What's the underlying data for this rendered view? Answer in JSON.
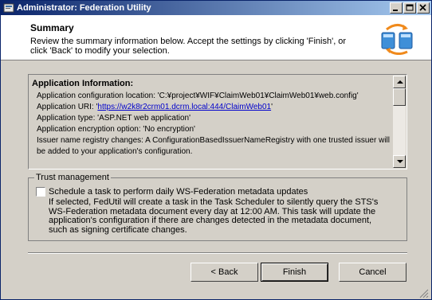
{
  "window": {
    "title": "Administrator: Federation Utility"
  },
  "header": {
    "title": "Summary",
    "description": "Review the summary information below. Accept the settings by clicking 'Finish', or click 'Back' to modify your selection."
  },
  "summary": {
    "heading": "Application Information:",
    "config_location": "Application configuration location: 'C:¥project¥WIF¥ClaimWeb01¥ClaimWeb01¥web.config'",
    "uri_prefix": "Application URI: '",
    "uri_link": "https://w2k8r2crm01.dcrm.local:444/ClaimWeb01",
    "uri_suffix": "'",
    "type": "Application type: 'ASP.NET web application'",
    "encryption": "Application encryption option: 'No encryption'",
    "registry": "Issuer name registry changes: A ConfigurationBasedIssuerNameRegistry with one trusted issuer will be added to your application's configuration."
  },
  "trust": {
    "legend": "Trust management",
    "checkbox_label": "Schedule a task to perform daily WS-Federation metadata updates",
    "checked": false,
    "description": "If selected, FedUtil will create a task in the Task Scheduler to silently query the STS's WS-Federation metadata document every day at 12:00 AM.  This task will update the application's configuration if there are changes detected in the metadata document, such as signing certificate changes."
  },
  "buttons": {
    "back": "< Back",
    "finish": "Finish",
    "cancel": "Cancel"
  },
  "icons": {
    "window": "app-icon",
    "header": "federation-icon"
  },
  "colors": {
    "title_start": "#0a246a",
    "title_end": "#a6caf0",
    "link": "#0000cc"
  }
}
